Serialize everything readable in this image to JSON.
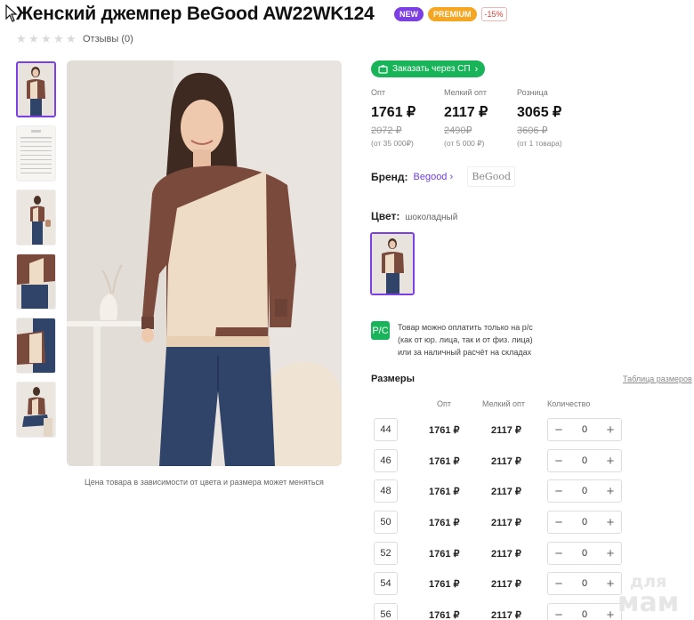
{
  "product": {
    "title": "Женский джемпер BeGood AW22WK124",
    "badges": {
      "new": "NEW",
      "premium": "PREMIUM",
      "discount": "-15%"
    },
    "rating_stars": 0,
    "reviews_label": "Отзывы (0)"
  },
  "gallery": {
    "caption": "Цена товара в зависимости от цвета и размера может меняться",
    "thumbnail_count": 6
  },
  "order": {
    "sp_button_label": "Заказать через СП"
  },
  "prices": [
    {
      "label": "Опт",
      "value": "1761 ₽",
      "old": "2072 ₽",
      "condition": "(от 35 000₽)"
    },
    {
      "label": "Мелкий опт",
      "value": "2117 ₽",
      "old": "2490₽",
      "condition": "(от 5 000 ₽)"
    },
    {
      "label": "Розница",
      "value": "3065 ₽",
      "old": "3606 ₽",
      "condition": "(от 1 товара)"
    }
  ],
  "brand": {
    "label": "Бренд:",
    "name": "Begood",
    "logo_text": "BeGood"
  },
  "color": {
    "label": "Цвет:",
    "value": "шоколадный"
  },
  "payment": {
    "icon_text": "Р/С",
    "line1": "Товар можно оплатить только на р/с",
    "line2": "(как от юр. лица, так и от физ. лица)",
    "line3": "или за наличный расчёт на складах"
  },
  "sizes": {
    "title": "Размеры",
    "table_link": "Таблица размеров",
    "headers": {
      "opt": "Опт",
      "small_opt": "Мелкий опт",
      "quantity": "Количество"
    },
    "rows": [
      {
        "size": "44",
        "opt": "1761 ₽",
        "small_opt": "2117 ₽",
        "qty": "0"
      },
      {
        "size": "46",
        "opt": "1761 ₽",
        "small_opt": "2117 ₽",
        "qty": "0"
      },
      {
        "size": "48",
        "opt": "1761 ₽",
        "small_opt": "2117 ₽",
        "qty": "0"
      },
      {
        "size": "50",
        "opt": "1761 ₽",
        "small_opt": "2117 ₽",
        "qty": "0"
      },
      {
        "size": "52",
        "opt": "1761 ₽",
        "small_opt": "2117 ₽",
        "qty": "0"
      },
      {
        "size": "54",
        "opt": "1761 ₽",
        "small_opt": "2117 ₽",
        "qty": "0"
      },
      {
        "size": "56",
        "opt": "1761 ₽",
        "small_opt": "2117 ₽",
        "qty": "0"
      }
    ]
  },
  "watermark": {
    "line1": "для",
    "line2": "мам"
  },
  "colors": {
    "accent": "#7b3fe4",
    "green": "#19b35a",
    "premium": "#f5a623",
    "sweater_brown": "#7a4a3c",
    "sweater_beige": "#efdcc6",
    "jeans": "#2f4468"
  }
}
